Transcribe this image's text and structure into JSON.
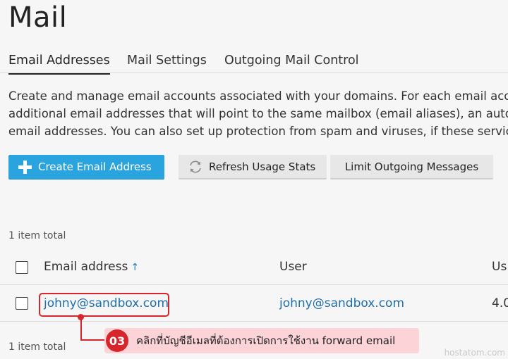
{
  "page": {
    "title": "Mail"
  },
  "tabs": [
    {
      "label": "Email Addresses",
      "active": true
    },
    {
      "label": "Mail Settings",
      "active": false
    },
    {
      "label": "Outgoing Mail Control",
      "active": false
    }
  ],
  "description": {
    "lines": [
      "Create and manage email accounts associated with your domains. For each email accou",
      "additional email addresses that will point to the same mailbox (email aliases), an auto-r",
      "email addresses. You can also set up protection from spam and viruses, if these service"
    ]
  },
  "toolbar": {
    "create_label": "Create Email Address",
    "refresh_label": "Refresh Usage Stats",
    "limit_label": "Limit Outgoing Messages"
  },
  "list": {
    "total_top": "1 item total",
    "total_bottom": "1 item total",
    "columns": {
      "email": "Email address",
      "sort_indicator": "↑",
      "user": "User",
      "usage": "Us"
    },
    "rows": [
      {
        "email": "johny@sandbox.com",
        "user": "johny@sandbox.com",
        "usage": "4.0"
      }
    ]
  },
  "annotation": {
    "step": "03",
    "text": "คลิกที่บัญชีอีเมลที่ต้องการเปิดการใช้งาน forward email",
    "color": "#d7262b"
  },
  "watermark": "hostatom.com",
  "colors": {
    "primary": "#29a4df",
    "link": "#1e6ea8",
    "highlight": "#d7262b"
  }
}
